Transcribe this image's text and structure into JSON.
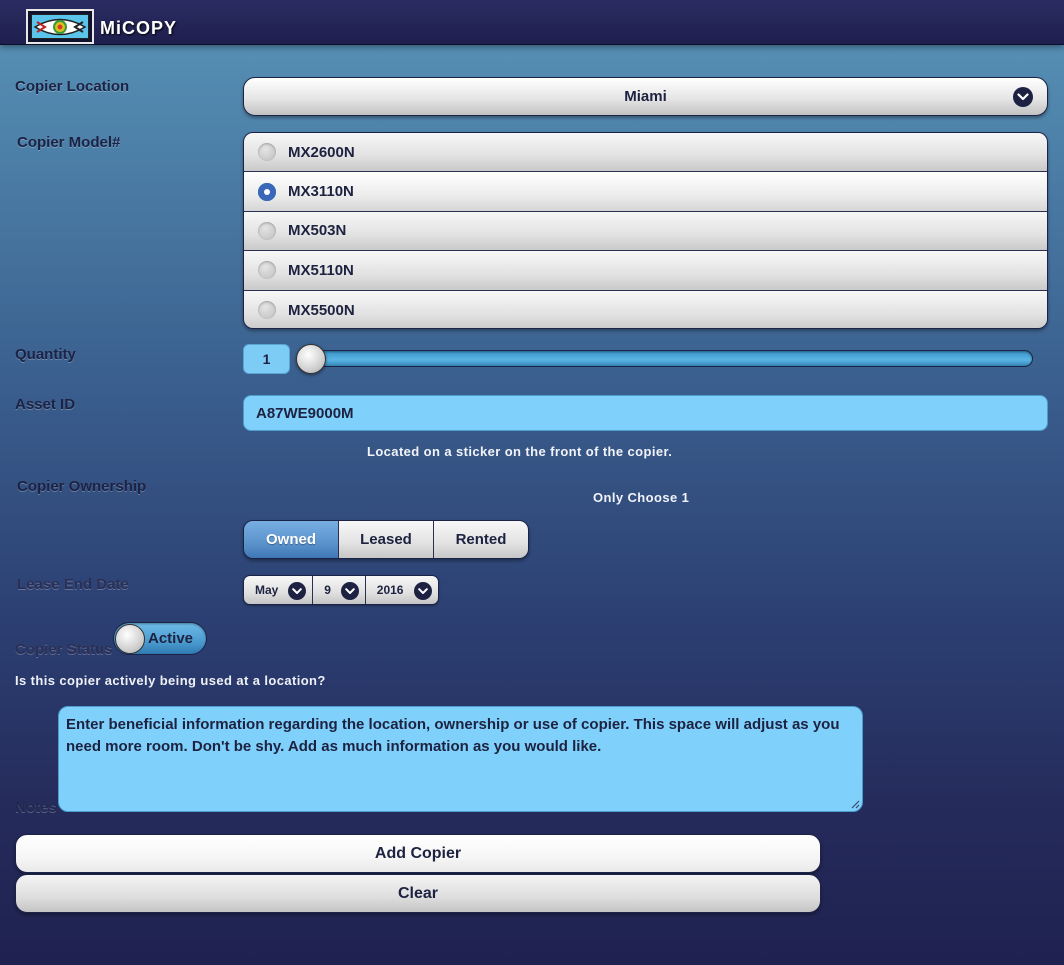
{
  "header": {
    "app_title": "MiCOPY"
  },
  "labels": {
    "location": "Copier Location",
    "model": "Copier Model#",
    "quantity": "Quantity",
    "asset_id": "Asset ID",
    "ownership": "Copier Ownership",
    "lease_end": "Lease End Date",
    "status": "Copier Status",
    "notes": "Notes"
  },
  "location": {
    "selected": "Miami",
    "icon": "chevron-down-icon"
  },
  "models": [
    {
      "label": "MX2600N",
      "selected": false
    },
    {
      "label": "MX3110N",
      "selected": true
    },
    {
      "label": "MX503N",
      "selected": false
    },
    {
      "label": "MX5110N",
      "selected": false
    },
    {
      "label": "MX5500N",
      "selected": false
    }
  ],
  "quantity": {
    "value": "1"
  },
  "asset": {
    "value": "A87WE9000M",
    "hint": "Located on a sticker on the front of the copier."
  },
  "ownership": {
    "hint": "Only Choose 1",
    "options": [
      "Owned",
      "Leased",
      "Rented"
    ],
    "selected": "Owned"
  },
  "lease_end": {
    "month": "May",
    "day": "9",
    "year": "2016"
  },
  "status": {
    "value": "Active",
    "question": "Is this copier actively being used at a location?"
  },
  "notes": {
    "value": "Enter beneficial information regarding the location, ownership or use of copier. This space will adjust as you need more room. Don't be shy. Add as much information as you would like."
  },
  "buttons": {
    "add": "Add Copier",
    "clear": "Clear"
  },
  "colors": {
    "accent": "#5a93cc",
    "input_bg": "#7fd0fb",
    "header_bg": "#1e1f4e"
  }
}
